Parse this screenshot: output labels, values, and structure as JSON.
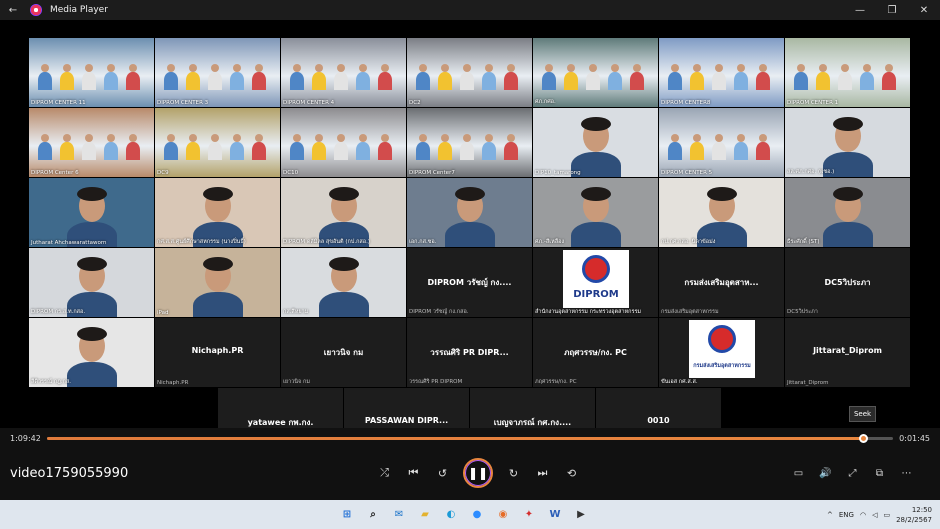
{
  "window": {
    "title": "Media Player",
    "back_icon": "arrow-left-icon",
    "minimize_icon": "minimize-icon",
    "maximize_icon": "maximize-icon",
    "close_icon": "close-icon"
  },
  "tiles": [
    {
      "label": "DIPROM CENTER 11",
      "kind": "video",
      "color": "#6c8fb0"
    },
    {
      "label": "DIPROM CENTER 3",
      "kind": "video",
      "color": "#7e96b7"
    },
    {
      "label": "DIPROM CENTER 4",
      "kind": "video",
      "color": "#8a8f9a"
    },
    {
      "label": "DC2",
      "kind": "video",
      "color": "#7b7e85"
    },
    {
      "label": "ศภ.กศอ.",
      "kind": "video",
      "color": "#5f7b7a"
    },
    {
      "label": "DIPROM CENTER8",
      "kind": "video",
      "color": "#7f9bc4"
    },
    {
      "label": "DIPROM CENTER 1",
      "kind": "video",
      "color": "#a9b8a3"
    },
    {
      "label": "DIPROM Center 6",
      "kind": "video",
      "color": "#b88a6a"
    },
    {
      "label": "DC9",
      "kind": "video",
      "color": "#b3a26a"
    },
    {
      "label": "DC10",
      "kind": "video",
      "color": "#8d8c8f"
    },
    {
      "label": "DIPROM Center7",
      "kind": "video",
      "color": "#6b6e72"
    },
    {
      "label": "DIP10_tamarong",
      "kind": "person",
      "color": "#d9dde2"
    },
    {
      "label": "DIPROM CENTER 5",
      "kind": "video",
      "color": "#9aa5b4"
    },
    {
      "label": "สล.ศภ.กศอ. (ผชอ.)",
      "kind": "person",
      "color": "#d6dadf"
    },
    {
      "label": "Jutharat Ahchawarattaworn",
      "kind": "person",
      "color": "#3f6a8c"
    },
    {
      "label": "กศ.ส.ส.ศูนย์ศึกษาสหกรรม (นางปิ่นธิ์)",
      "kind": "person",
      "color": "#d9c7b6"
    },
    {
      "label": "DIPROM ดลัมิลล สุขอันติ (กป.กสอ.)",
      "kind": "person",
      "color": "#d7d2cb"
    },
    {
      "label": "เอก.กส.ซอ.",
      "kind": "person",
      "color": "#6e7d8f"
    },
    {
      "label": "ศภ.-สีเหลือง",
      "kind": "person",
      "color": "#9a9c9e"
    },
    {
      "label": "กป.กศ.กสอ. นิดาข้อม่ง",
      "kind": "person",
      "color": "#e4e1dc"
    },
    {
      "label": "ธีระศักดิ์ (ST)",
      "kind": "person",
      "color": "#8a8c90"
    },
    {
      "label": "DIPROM กร.ส.ท.กสอ.",
      "kind": "person",
      "color": "#d5d8dc"
    },
    {
      "label": "iPad",
      "kind": "person",
      "color": "#c6b39a"
    },
    {
      "label": "กส.สีหยาม",
      "kind": "person",
      "color": "#d9dcdf"
    },
    {
      "label": "DIPROM วรัชญ์ กง.กสอ.",
      "kind": "name",
      "name": "DIPROM วรัชญ์ กง...."
    },
    {
      "label": "สำนักงานอุตสาหกรรม กระทรวงอุตสาหกรรม",
      "kind": "logo",
      "logo": "DIPROM"
    },
    {
      "label": "กรมส่งเสริมอุตสาหกรรม",
      "kind": "name",
      "name": "กรมส่งเสริมอุตสาห..."
    },
    {
      "label": "DC5วิประภา",
      "kind": "name",
      "name": "DC5วิประภา"
    },
    {
      "label": "ลีดิวรรณ์ กฎ.กส.",
      "kind": "person",
      "color": "#e6e6e6"
    },
    {
      "label": "Nichaph.PR",
      "kind": "name",
      "name": "Nichaph.PR"
    },
    {
      "label": "เยาวนิจ  กม",
      "kind": "name",
      "name": "เยาวนิจ  กม"
    },
    {
      "label": "วรรณศิริ PR DIPROM",
      "kind": "name",
      "name": "วรรณศิริ PR DIPR..."
    },
    {
      "label": "ภฤศวรรษ/กง. PC",
      "kind": "name",
      "name": "ภฤศวรรษ/กง. PC"
    },
    {
      "label": "ขันเอส กศ.ส.ส.",
      "kind": "logo",
      "logo": "กรมส่งเสริมอุตสาหกรรม"
    },
    {
      "label": "Jittarat_Diprom",
      "kind": "name",
      "name": "Jittarat_Diprom"
    },
    {
      "label": "yatawee กพ.กง.",
      "kind": "name",
      "name": "yatawee กพ.กง."
    },
    {
      "label": "PASSAWAN DIPROM",
      "kind": "name",
      "name": "PASSAWAN  DIPR..."
    },
    {
      "label": "เบญจาภรณ์ กศ.กง.",
      "kind": "name",
      "name": "เบญจาภรณ์ กศ.กง...."
    },
    {
      "label": "0010",
      "kind": "name",
      "name": "0010"
    }
  ],
  "player": {
    "elapsed": "1:09:42",
    "remaining": "0:01:45",
    "progress": 0.966,
    "video_title": "video1759055990",
    "seek_tooltip": "Seek",
    "accent": "#e8863f"
  },
  "controls": [
    {
      "name": "shuffle-button",
      "icon": "shuffle-icon",
      "glyph": "⤮"
    },
    {
      "name": "previous-button",
      "icon": "previous-icon",
      "glyph": "⏮"
    },
    {
      "name": "rewind-10-button",
      "icon": "rewind-10-icon",
      "glyph": "↺"
    },
    {
      "name": "pause-button",
      "icon": "pause-icon",
      "glyph": "❚❚"
    },
    {
      "name": "forward-30-button",
      "icon": "forward-30-icon",
      "glyph": "↻"
    },
    {
      "name": "next-button",
      "icon": "next-icon",
      "glyph": "⏭"
    },
    {
      "name": "repeat-off-button",
      "icon": "repeat-off-icon",
      "glyph": "⟲"
    }
  ],
  "right_controls": [
    {
      "name": "captions-button",
      "icon": "captions-icon",
      "glyph": "▭"
    },
    {
      "name": "volume-button",
      "icon": "volume-icon",
      "glyph": "🔊"
    },
    {
      "name": "fullscreen-button",
      "icon": "fullscreen-icon",
      "glyph": "⤢"
    },
    {
      "name": "mini-player-button",
      "icon": "mini-player-icon",
      "glyph": "⧉"
    },
    {
      "name": "more-options-button",
      "icon": "more-icon",
      "glyph": "⋯"
    }
  ],
  "taskbar": {
    "apps": [
      {
        "name": "start-button",
        "icon": "windows-icon",
        "glyph": "⊞",
        "color": "#1f6fd6"
      },
      {
        "name": "search-button",
        "icon": "search-icon",
        "glyph": "⌕",
        "color": "#222"
      },
      {
        "name": "mail-app",
        "icon": "mail-icon",
        "glyph": "✉",
        "color": "#1a73c9"
      },
      {
        "name": "file-explorer-app",
        "icon": "folder-icon",
        "glyph": "▰",
        "color": "#e3b22e"
      },
      {
        "name": "edge-app",
        "icon": "edge-icon",
        "glyph": "◐",
        "color": "#1b9ad6"
      },
      {
        "name": "zoom-app",
        "icon": "zoom-icon",
        "glyph": "●",
        "color": "#2d8cff"
      },
      {
        "name": "firefox-app",
        "icon": "firefox-icon",
        "glyph": "◉",
        "color": "#e66b25"
      },
      {
        "name": "acrobat-app",
        "icon": "acrobat-icon",
        "glyph": "✦",
        "color": "#d42e2e"
      },
      {
        "name": "word-app",
        "icon": "word-icon",
        "glyph": "W",
        "color": "#2b5eb8"
      },
      {
        "name": "media-player-app",
        "icon": "media-player-icon",
        "glyph": "▶",
        "color": "#333"
      }
    ],
    "tray": {
      "chevron": "^",
      "language": "ENG",
      "time": "12:50",
      "date": "28/2/2567"
    }
  }
}
